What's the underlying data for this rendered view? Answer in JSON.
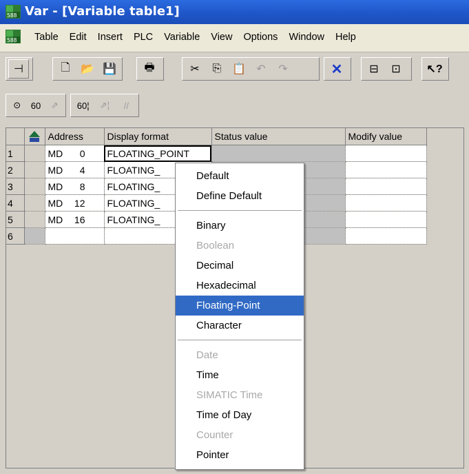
{
  "window": {
    "title": "Var - [Variable table1]",
    "app_icon": "var-app-icon"
  },
  "menubar": {
    "items": [
      "Table",
      "Edit",
      "Insert",
      "PLC",
      "Variable",
      "View",
      "Options",
      "Window",
      "Help"
    ]
  },
  "toolbar1": {
    "buttons": [
      "pin-icon",
      "new-icon",
      "open-icon",
      "save-icon",
      "print-icon",
      "cut-icon",
      "copy-icon",
      "paste-icon",
      "undo-icon",
      "redo-icon",
      "delete-icon",
      "plc-online-icon",
      "plc-offline-icon",
      "help-pointer-icon"
    ]
  },
  "toolbar2": {
    "buttons": [
      "connect-icon",
      "monitor-icon",
      "modify-icon",
      "monitor-immediate-icon",
      "modify-immediate-icon",
      "force-icon"
    ]
  },
  "table": {
    "columns": [
      "Address",
      "Display format",
      "Status value",
      "Modify value"
    ],
    "rows": [
      {
        "num": "1",
        "type": "MD",
        "addr": "0",
        "format": "FLOATING_POINT"
      },
      {
        "num": "2",
        "type": "MD",
        "addr": "4",
        "format": "FLOATING_"
      },
      {
        "num": "3",
        "type": "MD",
        "addr": "8",
        "format": "FLOATING_"
      },
      {
        "num": "4",
        "type": "MD",
        "addr": "12",
        "format": "FLOATING_"
      },
      {
        "num": "5",
        "type": "MD",
        "addr": "16",
        "format": "FLOATING_"
      },
      {
        "num": "6",
        "type": "",
        "addr": "",
        "format": ""
      }
    ]
  },
  "context_menu": {
    "items": [
      {
        "label": "Default",
        "enabled": true
      },
      {
        "label": "Define Default",
        "enabled": true
      },
      {
        "label": "Binary",
        "enabled": true
      },
      {
        "label": "Boolean",
        "enabled": false
      },
      {
        "label": "Decimal",
        "enabled": true
      },
      {
        "label": "Hexadecimal",
        "enabled": true
      },
      {
        "label": "Floating-Point",
        "enabled": true,
        "highlighted": true
      },
      {
        "label": "Character",
        "enabled": true
      },
      {
        "label": "Date",
        "enabled": false
      },
      {
        "label": "Time",
        "enabled": true
      },
      {
        "label": "SIMATIC Time",
        "enabled": false
      },
      {
        "label": "Time of Day",
        "enabled": true
      },
      {
        "label": "Counter",
        "enabled": false
      },
      {
        "label": "Pointer",
        "enabled": true
      }
    ]
  },
  "colors": {
    "titlebar": "#1f56c9",
    "highlight": "#316ac5",
    "face": "#d4d0c8"
  }
}
